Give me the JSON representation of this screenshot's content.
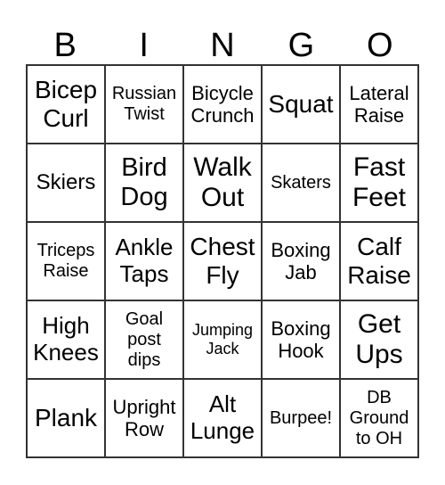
{
  "header": [
    "B",
    "I",
    "N",
    "G",
    "O"
  ],
  "cells": [
    [
      "Bicep\nCurl",
      "Russian\nTwist",
      "Bicycle\nCrunch",
      "Squat",
      "Lateral\nRaise"
    ],
    [
      "Skiers",
      "Bird\nDog",
      "Walk\nOut",
      "Skaters",
      "Fast\nFeet"
    ],
    [
      "Triceps\nRaise",
      "Ankle\nTaps",
      "Chest\nFly",
      "Boxing\nJab",
      "Calf\nRaise"
    ],
    [
      "High\nKnees",
      "Goal\npost\ndips",
      "Jumping\nJack",
      "Boxing\nHook",
      "Get\nUps"
    ],
    [
      "Plank",
      "Upright\nRow",
      "Alt\nLunge",
      "Burpee!",
      "DB\nGround\nto OH"
    ]
  ]
}
